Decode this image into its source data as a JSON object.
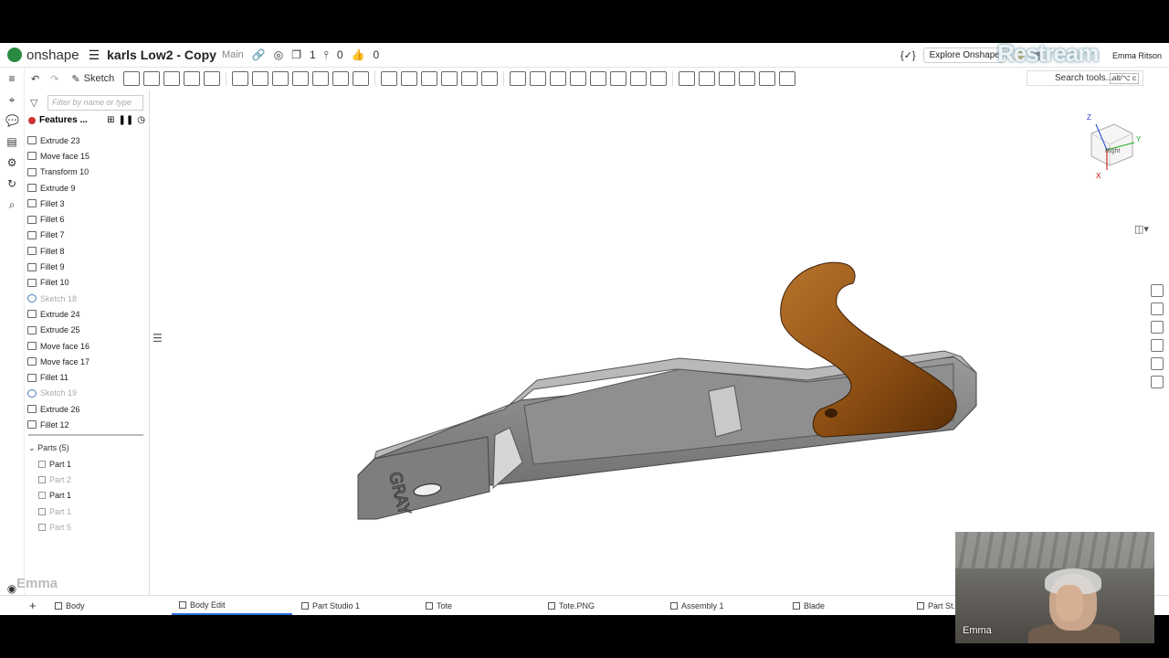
{
  "header": {
    "app_name": "onshape",
    "doc_title": "karls Low2 - Copy",
    "branch": "Main",
    "counts": [
      "1",
      "0",
      "0"
    ],
    "explore_label": "Explore Onshape",
    "overlay_brand": "Restream",
    "user_name": "Emma Ritson"
  },
  "toolbar": {
    "sketch_label": "Sketch",
    "search_placeholder": "Search tools...",
    "search_shortcut": "alt/⌥ c"
  },
  "panel": {
    "filter_placeholder": "Filter by name or type",
    "features_label": "Features ...",
    "features": [
      {
        "label": "Extrude 23",
        "suppressed": false
      },
      {
        "label": "Move face 15",
        "suppressed": false
      },
      {
        "label": "Transform 10",
        "suppressed": false
      },
      {
        "label": "Extrude 9",
        "suppressed": false
      },
      {
        "label": "Fillet 3",
        "suppressed": false
      },
      {
        "label": "Fillet 6",
        "suppressed": false
      },
      {
        "label": "Fillet 7",
        "suppressed": false
      },
      {
        "label": "Fillet 8",
        "suppressed": false
      },
      {
        "label": "Fillet 9",
        "suppressed": false
      },
      {
        "label": "Fillet 10",
        "suppressed": false
      },
      {
        "label": "Sketch 18",
        "suppressed": true
      },
      {
        "label": "Extrude 24",
        "suppressed": false
      },
      {
        "label": "Extrude 25",
        "suppressed": false
      },
      {
        "label": "Move face 16",
        "suppressed": false
      },
      {
        "label": "Move face 17",
        "suppressed": false
      },
      {
        "label": "Fillet 11",
        "suppressed": false
      },
      {
        "label": "Sketch 19",
        "suppressed": true
      },
      {
        "label": "Extrude 26",
        "suppressed": false
      },
      {
        "label": "Fillet 12",
        "suppressed": false
      }
    ],
    "parts_label": "Parts (5)",
    "parts": [
      {
        "label": "Part 1",
        "hidden": false
      },
      {
        "label": "Part 2",
        "hidden": true
      },
      {
        "label": "Part 1",
        "hidden": false
      },
      {
        "label": "Part 1",
        "hidden": true
      },
      {
        "label": "Part 5",
        "hidden": true
      }
    ]
  },
  "viewport": {
    "model_engraving": "GRAY",
    "view_cube_face": "Right",
    "axes": [
      "Z",
      "Y",
      "X"
    ],
    "colors": {
      "body": "#8a8a8a",
      "tote": "#9a5a1a"
    }
  },
  "overlay_name": "Emma",
  "tabs": [
    {
      "label": "Body"
    },
    {
      "label": "Body Edit"
    },
    {
      "label": "Part Studio 1"
    },
    {
      "label": "Tote"
    },
    {
      "label": "Tote.PNG"
    },
    {
      "label": "Assembly 1"
    },
    {
      "label": "Blade"
    },
    {
      "label": "Part St..."
    }
  ],
  "webcam": {
    "name": "Emma"
  }
}
